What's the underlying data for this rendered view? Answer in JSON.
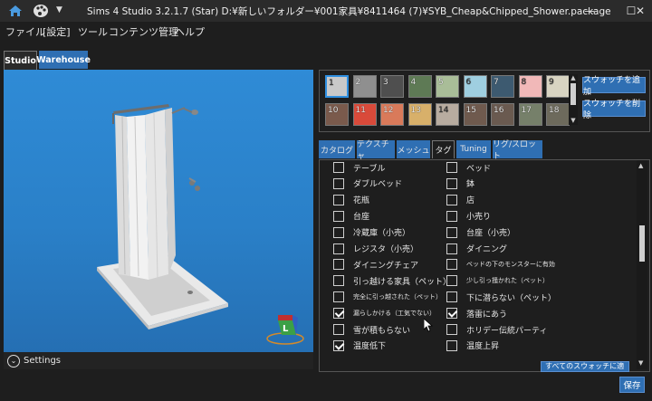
{
  "window": {
    "title": "Sims 4 Studio 3.2.1.7 (Star)  D:¥新しいフォルダー¥001家具¥8411464 (7)¥SYB_Cheap&Chipped_Shower.package",
    "minimize": "—",
    "maximize": "☐",
    "close": "✕"
  },
  "menu": [
    "ファイル",
    "[設定]",
    "ツール",
    "コンテンツ管理",
    "ヘルプ"
  ],
  "top_tabs": {
    "studio": "Studio",
    "warehouse": "Warehouse"
  },
  "viewport": {
    "settings_label": "Settings",
    "gizmo_label": "L"
  },
  "swatches": [
    {
      "n": "1",
      "color": "#c9c9c9"
    },
    {
      "n": "2",
      "color": "#8f8f8f"
    },
    {
      "n": "3",
      "color": "#4f4f4f"
    },
    {
      "n": "4",
      "color": "#5e7a55"
    },
    {
      "n": "5",
      "color": "#a9bd98"
    },
    {
      "n": "6",
      "color": "#9fcfe0"
    },
    {
      "n": "7",
      "color": "#3d5a70"
    },
    {
      "n": "8",
      "color": "#f1b8b8"
    },
    {
      "n": "9",
      "color": "#d8d4c2"
    },
    {
      "n": "10",
      "color": "#7a5a4c"
    },
    {
      "n": "11",
      "color": "#d94a3a"
    },
    {
      "n": "12",
      "color": "#d97a5a"
    },
    {
      "n": "13",
      "color": "#d8b06a"
    },
    {
      "n": "14",
      "color": "#b8aca0"
    },
    {
      "n": "15",
      "color": "#6f5a4e"
    },
    {
      "n": "16",
      "color": "#6a5a50"
    },
    {
      "n": "17",
      "color": "#76806a"
    },
    {
      "n": "18",
      "color": "#6d6a5c"
    }
  ],
  "swatch_buttons": {
    "add": "スウォッチを追加",
    "delete": "スウォッチを削除"
  },
  "sub_tabs": [
    "カタログ",
    "テクスチャ",
    "メッシュ",
    "タグ",
    "Tuning",
    "リグ/スロット"
  ],
  "tags_left": [
    {
      "label": "テーブル",
      "checked": false
    },
    {
      "label": "ダブルベッド",
      "checked": false
    },
    {
      "label": "花瓶",
      "checked": false
    },
    {
      "label": "台座",
      "checked": false
    },
    {
      "label": "冷蔵庫（小売）",
      "checked": false
    },
    {
      "label": "レジスタ（小売）",
      "checked": false
    },
    {
      "label": "ダイニングチェア",
      "checked": false
    },
    {
      "label": "引っ越ける家具（ペット）",
      "checked": false
    },
    {
      "label": "完全に引っ越された（ペット）",
      "checked": false
    },
    {
      "label": "漏らしかける（工気でない）",
      "checked": true
    },
    {
      "label": "雪が積もらない",
      "checked": false
    },
    {
      "label": "温度低下",
      "checked": true
    }
  ],
  "tags_right": [
    {
      "label": "ベッド",
      "checked": false
    },
    {
      "label": "鉢",
      "checked": false
    },
    {
      "label": "店",
      "checked": false
    },
    {
      "label": "小売り",
      "checked": false
    },
    {
      "label": "台座（小売）",
      "checked": false
    },
    {
      "label": "ダイニング",
      "checked": false
    },
    {
      "label": "ベッドの下のモンスターに有効",
      "checked": false
    },
    {
      "label": "少し引っ掻かれた（ペット）",
      "checked": false
    },
    {
      "label": "下に潜らない（ペット）",
      "checked": false
    },
    {
      "label": "落雷にあう",
      "checked": true
    },
    {
      "label": "ホリデー伝統パーティ",
      "checked": false
    },
    {
      "label": "温度上昇",
      "checked": false
    }
  ],
  "apply_button": "すべてのスウォッチに適用",
  "save_button": "保存",
  "colors": {
    "accent": "#2f6fb3",
    "viewport": "#2a80c8"
  }
}
